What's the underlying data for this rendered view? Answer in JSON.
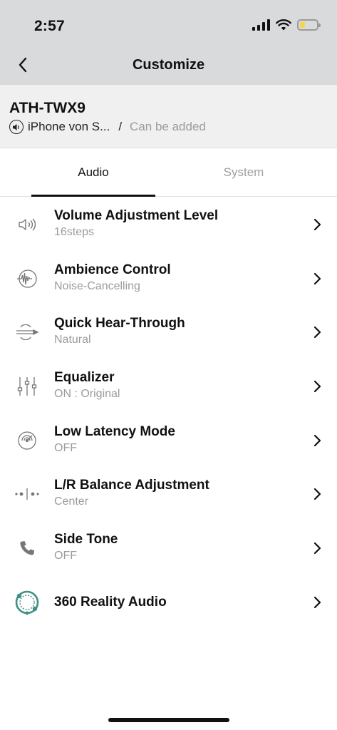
{
  "status_bar": {
    "time": "2:57",
    "battery_level": 0.3,
    "battery_color": "#f7d54a"
  },
  "nav": {
    "title": "Customize",
    "back_icon": "chevron-left-icon"
  },
  "device": {
    "name": "ATH-TWX9",
    "source": "iPhone von S...",
    "separator": "/",
    "status": "Can be added"
  },
  "tabs": [
    {
      "label": "Audio",
      "active": true
    },
    {
      "label": "System",
      "active": false
    }
  ],
  "settings": [
    {
      "icon": "speaker-volume-icon",
      "title": "Volume Adjustment Level",
      "value": "16steps"
    },
    {
      "icon": "ambience-waveform-icon",
      "title": "Ambience Control",
      "value": "Noise-Cancelling"
    },
    {
      "icon": "hear-through-icon",
      "title": "Quick Hear-Through",
      "value": "Natural"
    },
    {
      "icon": "equalizer-sliders-icon",
      "title": "Equalizer",
      "value": "ON : Original"
    },
    {
      "icon": "latency-gauge-icon",
      "title": "Low Latency Mode",
      "value": "OFF"
    },
    {
      "icon": "balance-dots-icon",
      "title": "L/R Balance Adjustment",
      "value": "Center"
    },
    {
      "icon": "phone-handset-icon",
      "title": "Side Tone",
      "value": "OFF"
    },
    {
      "icon": "reality-audio-icon",
      "title": "360 Reality Audio",
      "value": ""
    }
  ],
  "colors": {
    "header_bg": "#d9dadb",
    "device_bg": "#f0f0f0",
    "accent_green": "#3f8f83",
    "muted_text": "#9b9b9b"
  }
}
